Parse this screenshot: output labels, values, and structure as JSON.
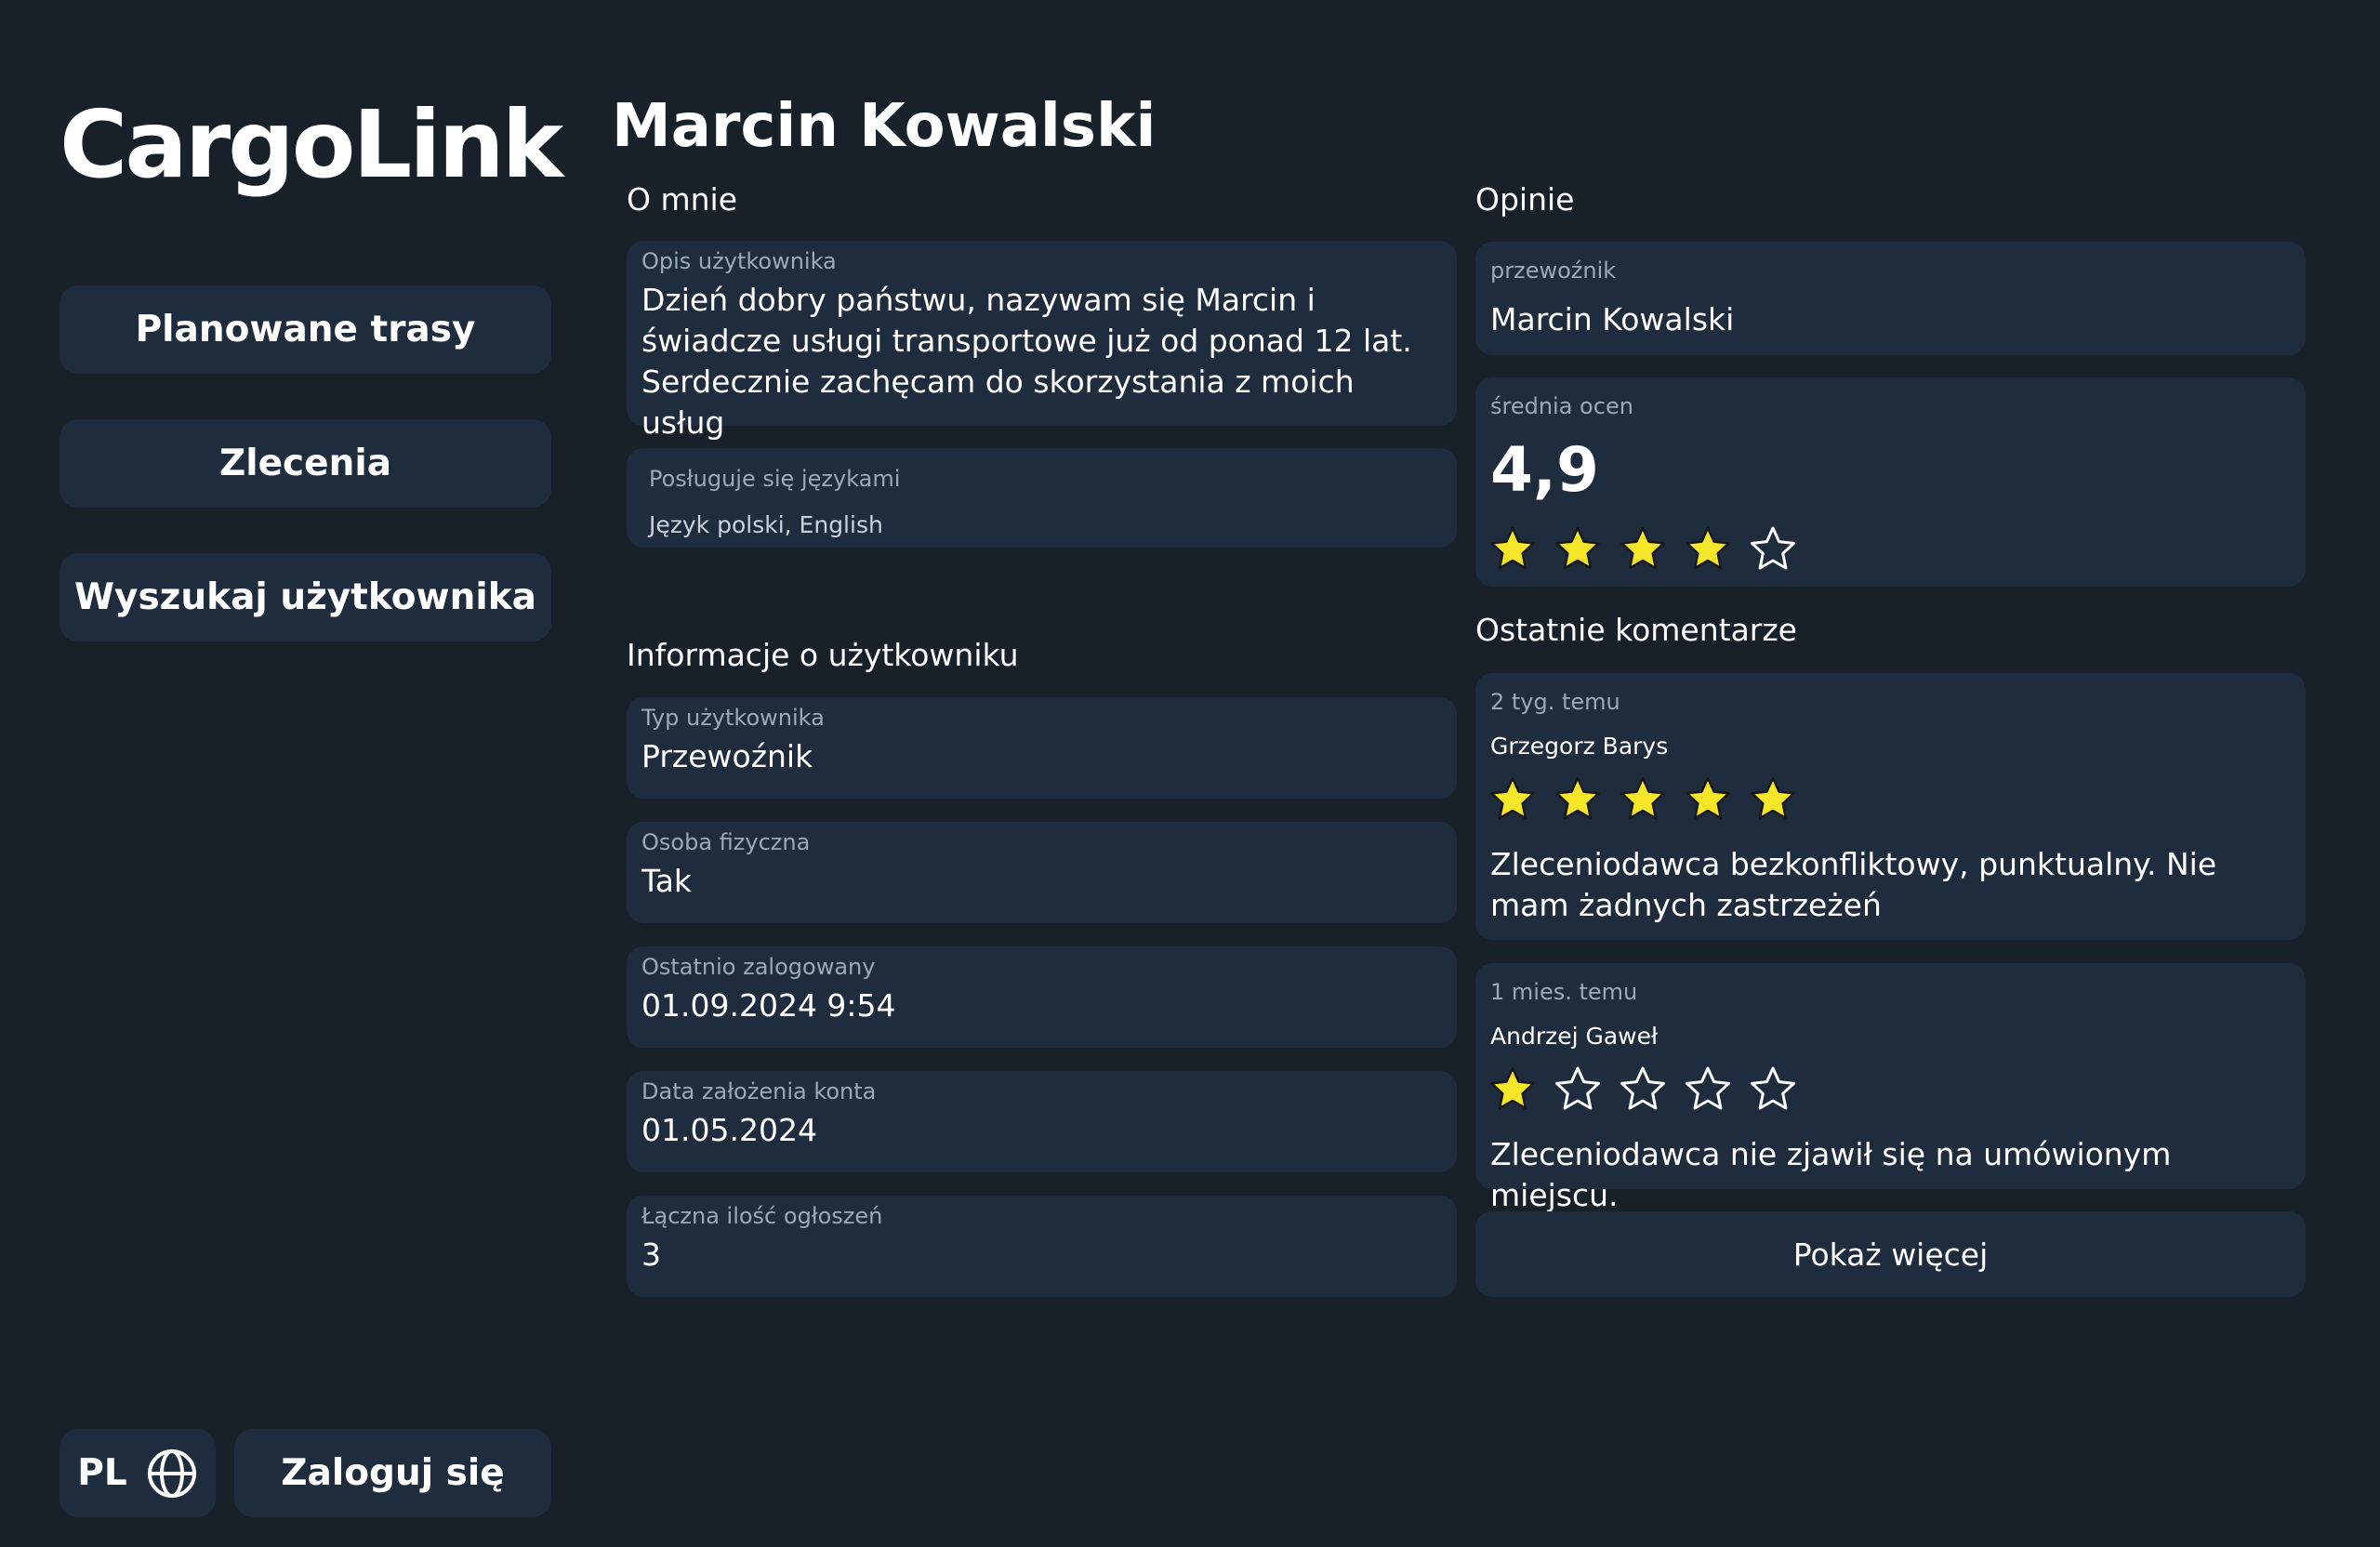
{
  "app": {
    "logo": "CargoLink"
  },
  "sidebar": {
    "items": [
      {
        "label": "Planowane trasy"
      },
      {
        "label": "Zlecenia"
      },
      {
        "label": "Wyszukaj użytkownika"
      }
    ],
    "language": "PL",
    "login_label": "Zaloguj się"
  },
  "profile": {
    "name": "Marcin Kowalski",
    "about": {
      "title": "O mnie",
      "description_label": "Opis użytkownika",
      "description": "Dzień dobry państwu, nazywam się Marcin i świadcze usługi transportowe już od ponad 12 lat. Serdecznie zachęcam do skorzystania z moich usług",
      "languages_label": "Posługuje się językami",
      "languages": "Język polski, English"
    },
    "info": {
      "title": "Informacje o użytkowniku",
      "fields": [
        {
          "label": "Typ użytkownika",
          "value": "Przewoźnik"
        },
        {
          "label": "Osoba fizyczna",
          "value": "Tak"
        },
        {
          "label": "Ostatnio zalogowany",
          "value": "01.09.2024 9:54"
        },
        {
          "label": "Data założenia konta",
          "value": "01.05.2024"
        },
        {
          "label": "Łączna ilość ogłoszeń",
          "value": "3"
        }
      ]
    }
  },
  "opinions": {
    "title": "Opinie",
    "carrier_label": "przewoźnik",
    "carrier_name": "Marcin Kowalski",
    "avg_label": "średnia ocen",
    "avg_value": "4,9",
    "avg_stars": 4,
    "comments_title": "Ostatnie komentarze",
    "comments": [
      {
        "time": "2 tyg. temu",
        "author": "Grzegorz Barys",
        "stars": 5,
        "text": "Zleceniodawca bezkonfliktowy, punktualny. Nie mam żadnych zastrzeżeń"
      },
      {
        "time": "1 mies. temu",
        "author": "Andrzej Gaweł",
        "stars": 1,
        "text": "Zleceniodawca nie zjawił się na umówionym miejscu."
      }
    ],
    "show_more": "Pokaż więcej"
  },
  "colors": {
    "background": "#18202a",
    "card": "#1f2c3d",
    "star_filled": "#f5e62a",
    "label_text": "#9aa9bb"
  },
  "icons": {
    "language": "globe-icon",
    "star_filled": "star-filled-icon",
    "star_empty": "star-outline-icon"
  }
}
